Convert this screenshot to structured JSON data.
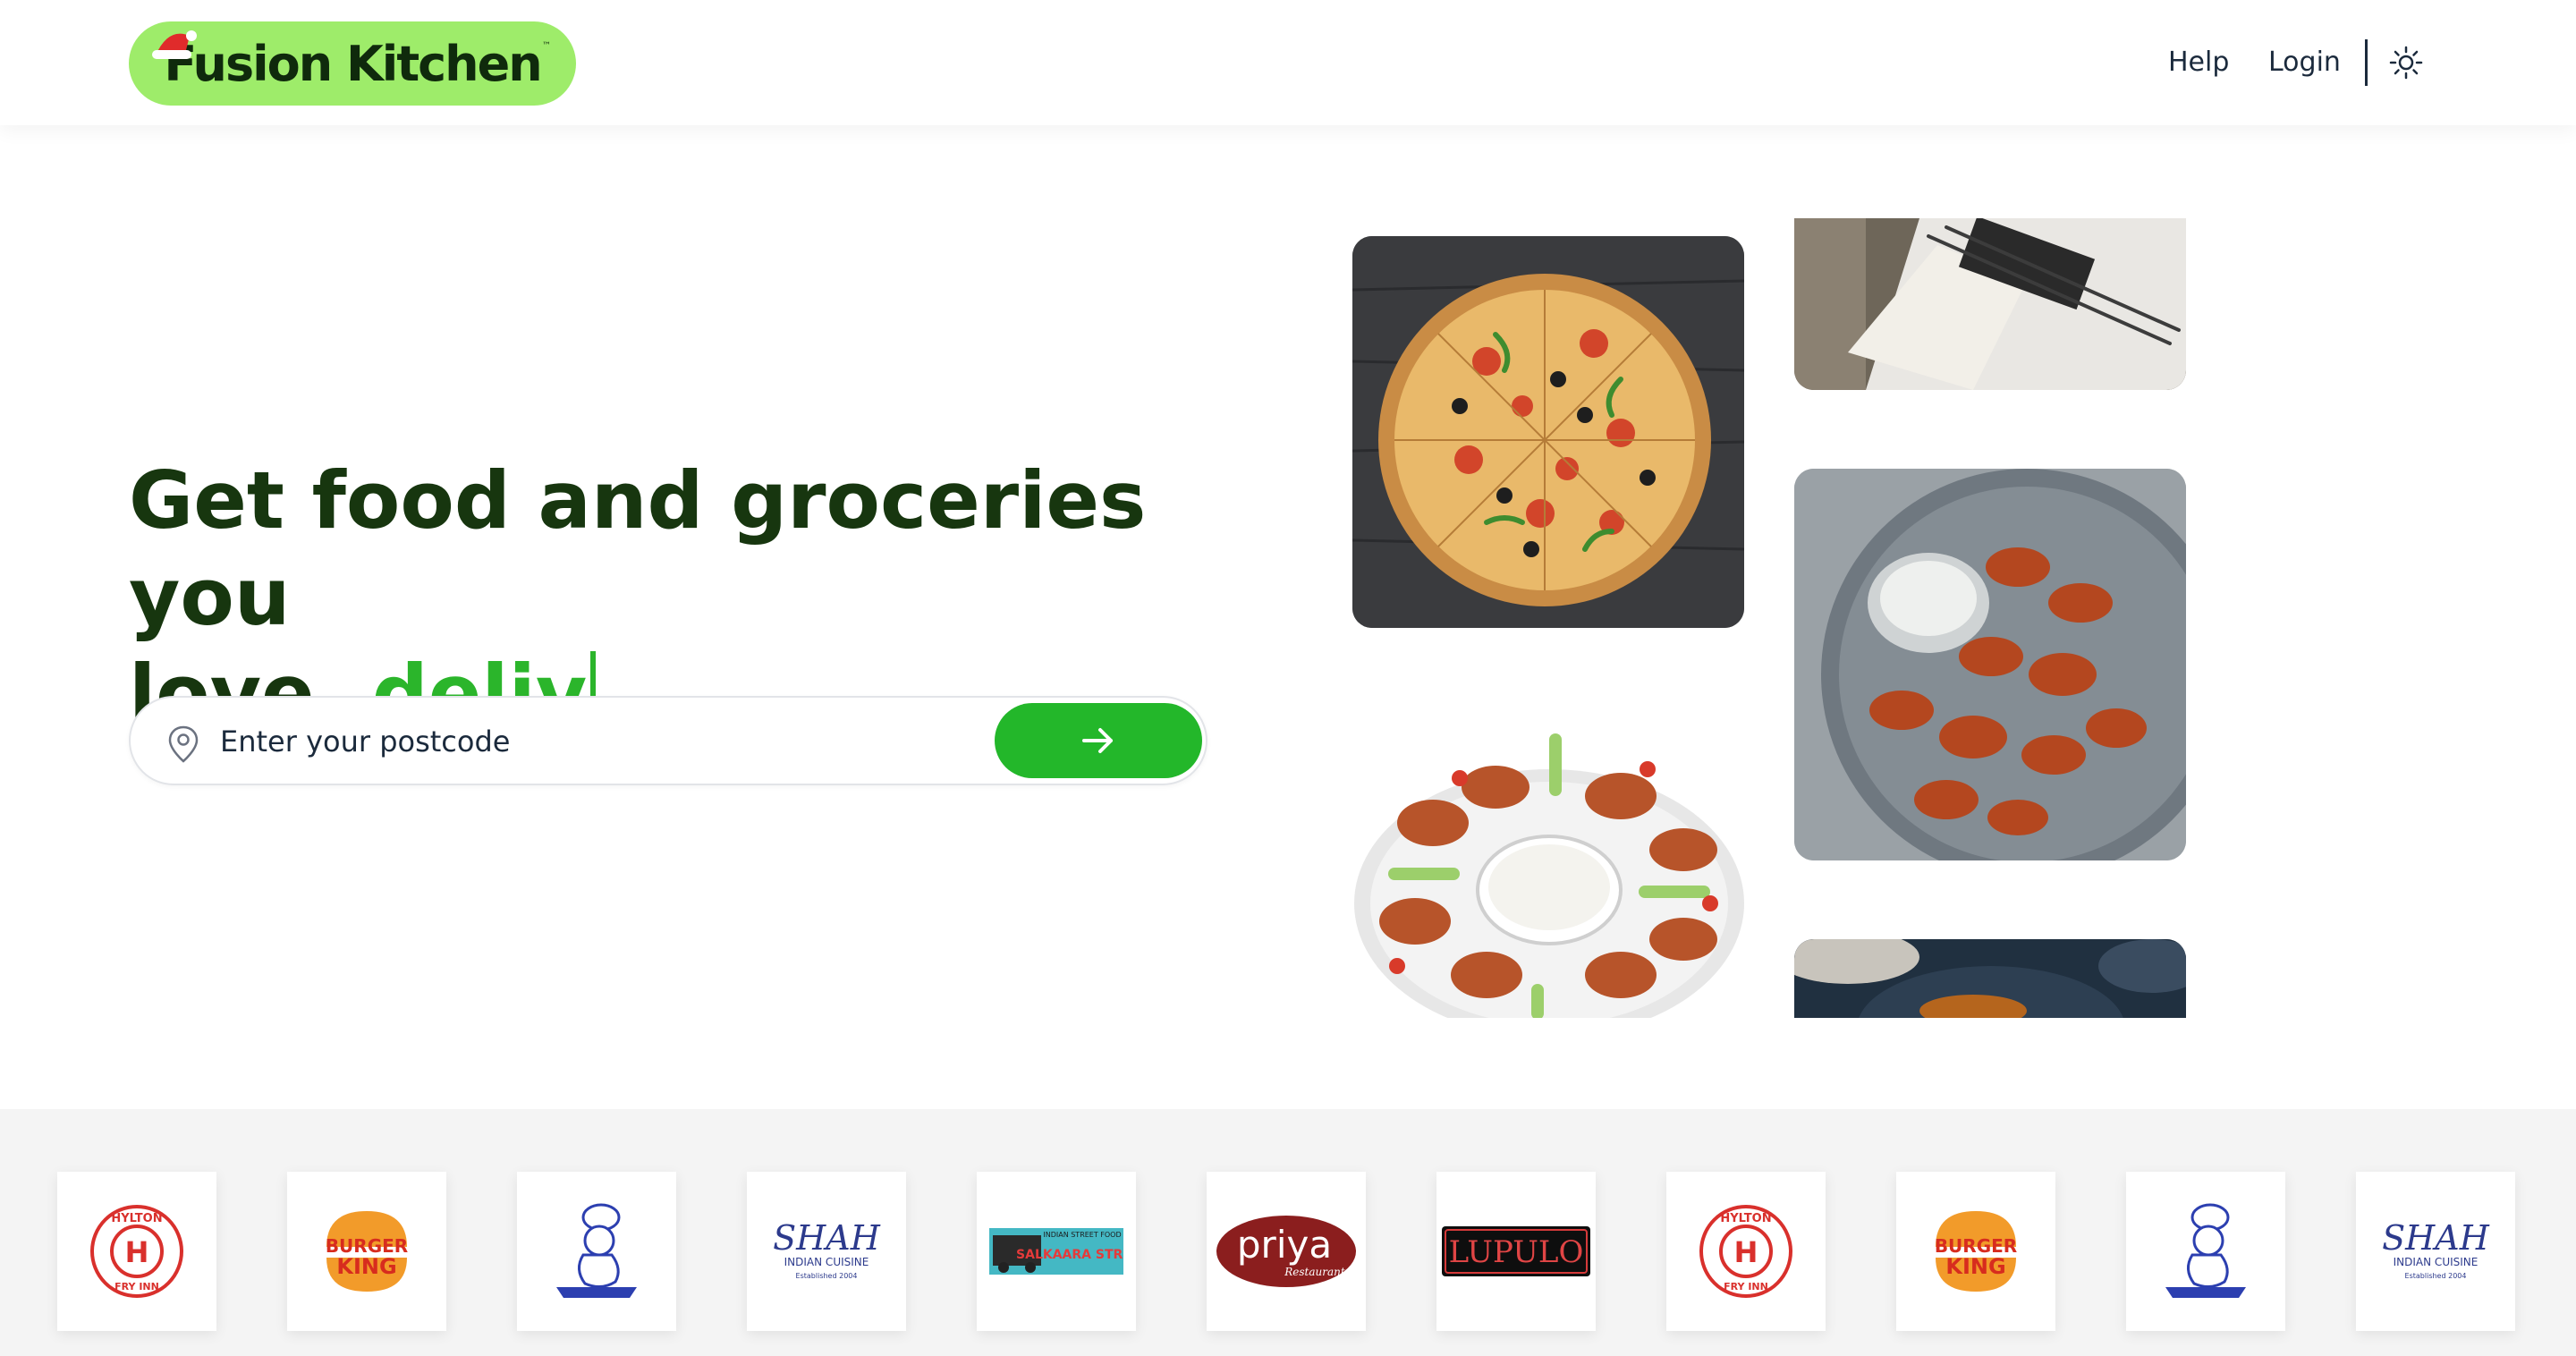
{
  "header": {
    "logo_text": "Fusion Kitchen",
    "logo_tm": "™",
    "nav": {
      "help": "Help",
      "login": "Login"
    }
  },
  "hero": {
    "title_line1": "Get food and groceries you",
    "title_line2_prefix": "love, ",
    "title_line2_accent": "deliv"
  },
  "search": {
    "placeholder": "Enter your postcode",
    "value": ""
  },
  "brands": [
    {
      "name": "Hylton Fry Inn",
      "text_top": "HYLTON",
      "text_bottom": "FRY INN",
      "letter": "H"
    },
    {
      "name": "Burger King",
      "line1": "BURGER",
      "line2": "KING"
    },
    {
      "name": "Chef Mascot"
    },
    {
      "name": "Shah Indian Cuisine",
      "line1": "SHAH",
      "line2": "INDIAN CUISINE",
      "line3": "Established 2004"
    },
    {
      "name": "Salkaara Street",
      "line1": "INDIAN STREET FOOD",
      "line2": "SALKAARA STREET"
    },
    {
      "name": "Priya Restaurant",
      "line1": "priya",
      "line2": "Restaurant"
    },
    {
      "name": "Lupulo",
      "line1": "LUPULO"
    },
    {
      "name": "Hylton Fry Inn",
      "text_top": "HYLTON",
      "text_bottom": "FRY INN",
      "letter": "H"
    },
    {
      "name": "Burger King",
      "line1": "BURGER",
      "line2": "KING"
    },
    {
      "name": "Chef Mascot"
    },
    {
      "name": "Shah Indian Cuisine",
      "line1": "SHAH",
      "line2": "INDIAN CUISINE",
      "line3": "Established 2004"
    }
  ],
  "colors": {
    "brand_green": "#23b72a",
    "logo_bg": "#9eec6a",
    "heading": "#17360f",
    "accent": "#2bb52b"
  }
}
